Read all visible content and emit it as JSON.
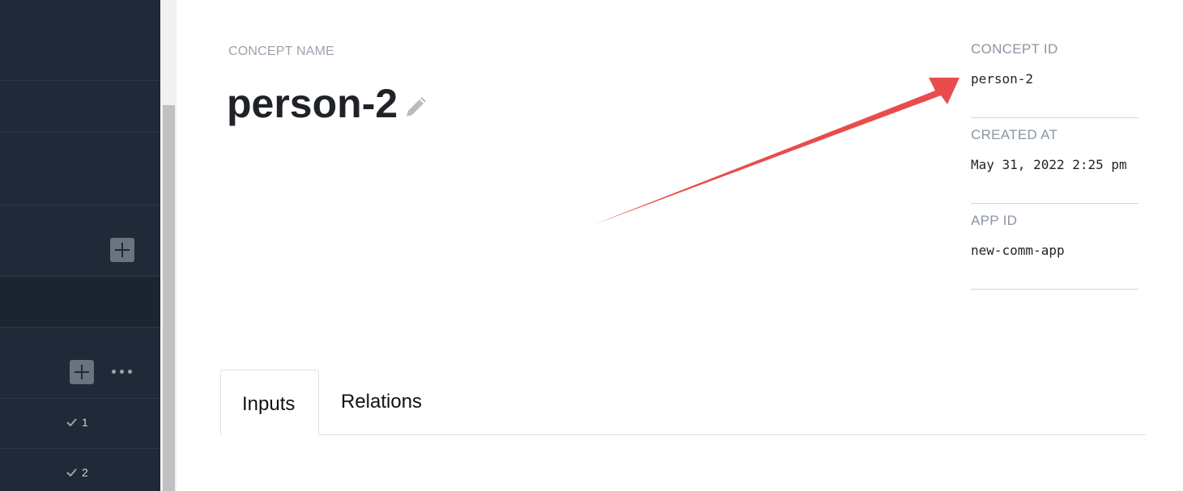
{
  "concept": {
    "name_label": "CONCEPT NAME",
    "name": "person-2"
  },
  "meta": {
    "concept_id_label": "CONCEPT ID",
    "concept_id": "person-2",
    "created_at_label": "CREATED AT",
    "created_at": "May 31, 2022 2:25 pm",
    "app_id_label": "APP ID",
    "app_id": "new-comm-app"
  },
  "tabs": {
    "inputs": "Inputs",
    "relations": "Relations"
  },
  "sidebar": {
    "items": [
      {
        "check": "1"
      },
      {
        "check": "2"
      }
    ],
    "icons": [
      "plus-icon",
      "plus-icon",
      "more-icon",
      "check-icon"
    ]
  },
  "colors": {
    "sidebar_bg": "#1f2937",
    "annotation_arrow": "#e84c4c"
  }
}
